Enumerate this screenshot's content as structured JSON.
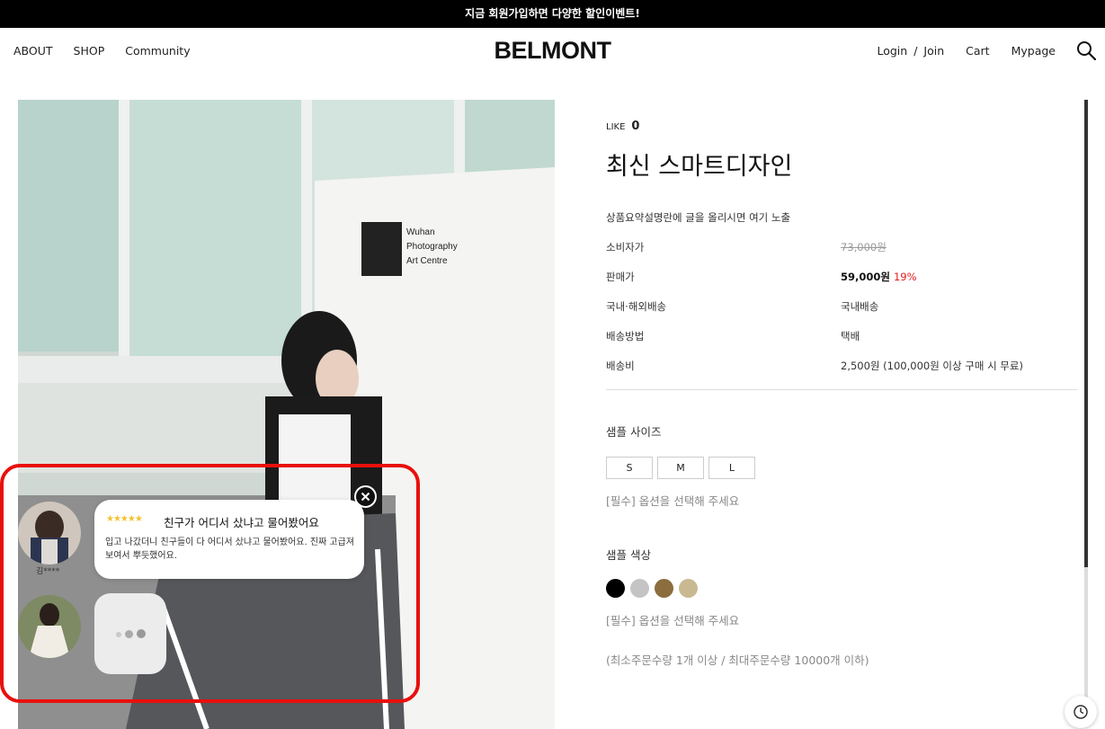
{
  "topbar": {
    "text": "지금 회원가입하면 다양한 할인이벤트!"
  },
  "nav": {
    "left": [
      "ABOUT",
      "SHOP",
      "Community"
    ],
    "logo": "BELMONT",
    "login": "Login",
    "separator": "/",
    "join": "Join",
    "cart": "Cart",
    "mypage": "Mypage"
  },
  "product": {
    "like_label": "LIKE",
    "like_count": "0",
    "title": "최신 스마트디자인",
    "summary": "상품요약설명란에 글을 올리시면 여기 노출",
    "specs": {
      "consumer_price_label": "소비자가",
      "consumer_price": "73,000원",
      "sale_price_label": "판매가",
      "sale_price": "59,000원",
      "discount": "19%",
      "shipping_type_label": "국내·해외배송",
      "shipping_type": "국내배송",
      "shipping_method_label": "배송방법",
      "shipping_method": "택배",
      "shipping_fee_label": "배송비",
      "shipping_fee": "2,500원 (100,000원 이상 구매 시 무료)"
    },
    "size_option": {
      "label": "샘플 사이즈",
      "options": [
        "S",
        "M",
        "L"
      ],
      "hint": "[필수] 옵션을 선택해 주세요"
    },
    "color_option": {
      "label": "샘플 색상",
      "swatches": [
        "#000000",
        "#c4c4c4",
        "#8c6d3e",
        "#c9b991"
      ],
      "hint": "[필수] 옵션을 선택해 주세요"
    },
    "qty_note": "(최소주문수량 1개 이상 / 최대주문수량 10000개 이하)"
  },
  "review_popup": {
    "stars": "★★★★★",
    "title": "친구가 어디서 샀냐고 물어봤어요",
    "body": "입고 나갔더니 친구들이 다 어디서 샀냐고 물어봤어요. 진짜 고급져 보여서 뿌듯했어요.",
    "reviewer": "김****"
  },
  "colors": {
    "highlight": "#e8100c",
    "discount": "#e21b1b",
    "star": "#f2c230"
  }
}
